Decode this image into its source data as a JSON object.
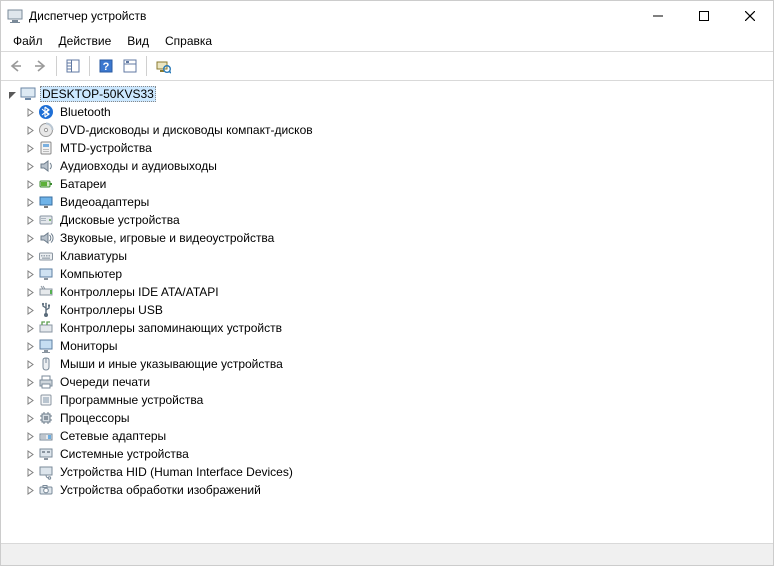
{
  "window": {
    "title": "Диспетчер устройств"
  },
  "menu": {
    "file": "Файл",
    "action": "Действие",
    "view": "Вид",
    "help": "Справка"
  },
  "tree": {
    "root": "DESKTOP-50KVS33",
    "items": [
      {
        "icon": "bluetooth",
        "label": "Bluetooth"
      },
      {
        "icon": "dvd",
        "label": "DVD-дисководы и дисководы компакт-дисков"
      },
      {
        "icon": "mtd",
        "label": "MTD-устройства"
      },
      {
        "icon": "audio",
        "label": "Аудиовходы и аудиовыходы"
      },
      {
        "icon": "battery",
        "label": "Батареи"
      },
      {
        "icon": "display",
        "label": "Видеоадаптеры"
      },
      {
        "icon": "disk",
        "label": "Дисковые устройства"
      },
      {
        "icon": "sound",
        "label": "Звуковые, игровые и видеоустройства"
      },
      {
        "icon": "keyboard",
        "label": "Клавиатуры"
      },
      {
        "icon": "computer",
        "label": "Компьютер"
      },
      {
        "icon": "ide",
        "label": "Контроллеры IDE ATA/ATAPI"
      },
      {
        "icon": "usb",
        "label": "Контроллеры USB"
      },
      {
        "icon": "storage-ctrl",
        "label": "Контроллеры запоминающих устройств"
      },
      {
        "icon": "monitor",
        "label": "Мониторы"
      },
      {
        "icon": "mouse",
        "label": "Мыши и иные указывающие устройства"
      },
      {
        "icon": "printer",
        "label": "Очереди печати"
      },
      {
        "icon": "software",
        "label": "Программные устройства"
      },
      {
        "icon": "cpu",
        "label": "Процессоры"
      },
      {
        "icon": "network",
        "label": "Сетевые адаптеры"
      },
      {
        "icon": "system",
        "label": "Системные устройства"
      },
      {
        "icon": "hid",
        "label": "Устройства HID (Human Interface Devices)"
      },
      {
        "icon": "imaging",
        "label": "Устройства обработки изображений"
      }
    ]
  }
}
